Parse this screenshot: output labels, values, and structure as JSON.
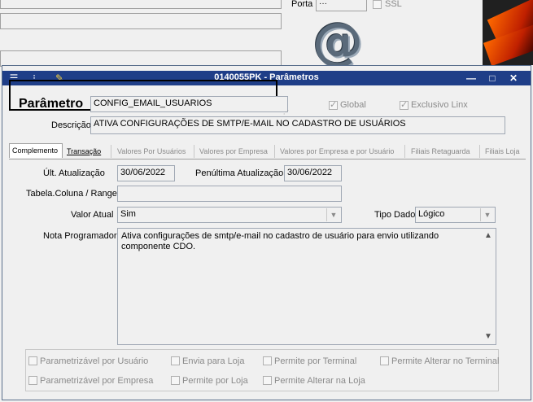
{
  "background": {
    "porta_label": "Porta",
    "porta_value": "···",
    "ssl_label": "SSL",
    "at_symbol": "@"
  },
  "window": {
    "title": "0140055PK - Parâmetros",
    "toolbar_icons": [
      "menu-icon",
      "traffic-light-icon",
      "pin-icon"
    ],
    "controls": {
      "minimize": "—",
      "maximize": "□",
      "close": "✕"
    }
  },
  "header": {
    "parametro_label": "Parâmetro",
    "parametro_value": "CONFIG_EMAIL_USUARIOS",
    "global_label": "Global",
    "global_checked": true,
    "exclusivo_label": "Exclusivo Linx",
    "exclusivo_checked": true,
    "descricao_label": "Descrição",
    "descricao_value": "ATIVA CONFIGURAÇÕES DE SMTP/E-MAIL NO CADASTRO DE USUÁRIOS"
  },
  "tabs": [
    {
      "label": "Complemento",
      "active": true
    },
    {
      "label": "Transação",
      "active": false
    },
    {
      "label": "Valores Por Usuários",
      "active": false
    },
    {
      "label": "Valores por Empresa",
      "active": false
    },
    {
      "label": "Valores por Empresa e por Usuário",
      "active": false
    },
    {
      "label": "Filiais Retaguarda",
      "active": false
    },
    {
      "label": "Filiais Loja",
      "active": false
    }
  ],
  "form": {
    "ult_atualizacao_label": "Últ. Atualização",
    "ult_atualizacao_value": "30/06/2022",
    "penultima_label": "Penúltima Atualização",
    "penultima_value": "30/06/2022",
    "tabela_label": "Tabela.Coluna / Range",
    "tabela_value": "",
    "valor_atual_label": "Valor Atual",
    "valor_atual_value": "Sim",
    "tipo_dado_label": "Tipo Dado",
    "tipo_dado_value": "Lógico",
    "nota_label": "Nota Programador",
    "nota_value": "Ativa configurações de smtp/e-mail no cadastro de usuário para envio utilizando componente CDO."
  },
  "options": {
    "parametrizavel_usuario": "Parametrizável por Usuário",
    "envia_para_loja": "Envia para Loja",
    "permite_terminal": "Permite por Terminal",
    "permite_alterar_terminal": "Permite Alterar no Terminal",
    "parametrizavel_empresa": "Parametrizável por Empresa",
    "permite_loja": "Permite por Loja",
    "permite_alterar_loja": "Permite Alterar na Loja"
  }
}
